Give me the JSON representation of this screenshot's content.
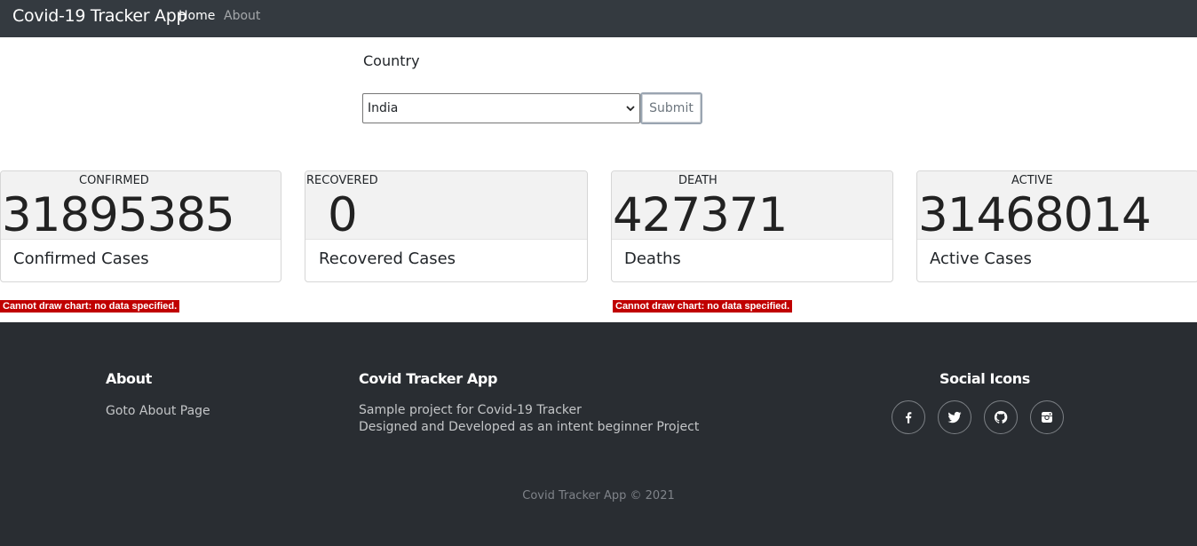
{
  "nav": {
    "brand": "Covid-19 Tracker App",
    "home": "Home",
    "about": "About"
  },
  "form": {
    "country_label": "Country",
    "selected_country": "India",
    "submit_label": "Submit"
  },
  "cards": [
    {
      "title": "CONFIRMED",
      "value": "31895385",
      "subtitle": "Confirmed Cases"
    },
    {
      "title": "RECOVERED",
      "value": "0",
      "subtitle": "Recovered Cases"
    },
    {
      "title": "DEATH",
      "value": "427371",
      "subtitle": "Deaths"
    },
    {
      "title": "ACTIVE",
      "value": "31468014",
      "subtitle": "Active Cases"
    }
  ],
  "chart_errors": [
    "Cannot draw chart: no data specified.",
    "Cannot draw chart: no data specified."
  ],
  "footer": {
    "about_heading": "About",
    "about_link": "Goto About Page",
    "app_heading": "Covid Tracker App",
    "app_line1": "Sample project for Covid-19 Tracker",
    "app_line2": "Designed and Developed as an intent beginner Project",
    "social_heading": "Social Icons",
    "social_icons": [
      "facebook-icon",
      "twitter-icon",
      "github-icon",
      "instagram-icon"
    ],
    "copyright": "Covid Tracker App © 2021"
  },
  "colors": {
    "navbar": "#343a40",
    "footer": "#292d32",
    "error": "#c00000"
  }
}
